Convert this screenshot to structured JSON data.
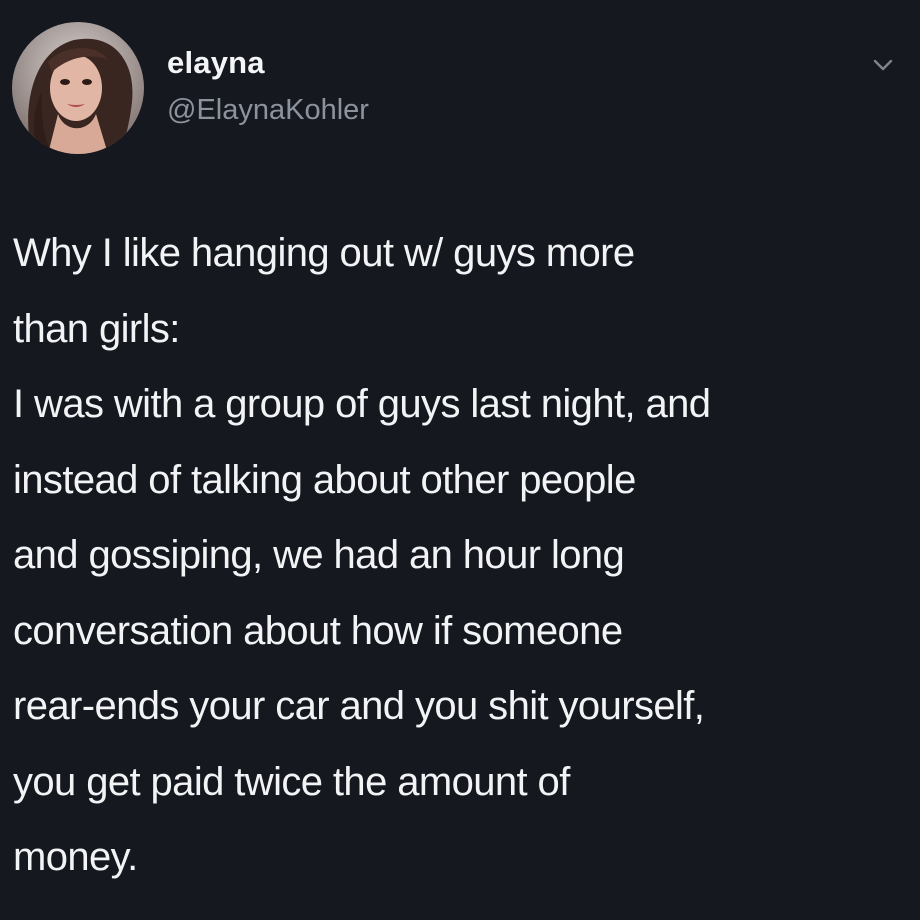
{
  "user": {
    "display_name": "elayna",
    "handle": "@ElaynaKohler",
    "avatar_icon": "profile-photo"
  },
  "menu": {
    "icon": "chevron-down-icon"
  },
  "tweet": {
    "lines": [
      "Why I like hanging out w/ guys more",
      "than girls:",
      "I was with a group of guys last night, and",
      "instead of talking about other people",
      "and gossiping, we had an hour long",
      "conversation about how if someone",
      "rear-ends your car and you shit yourself,",
      "you get paid twice the amount of",
      "money."
    ]
  },
  "colors": {
    "background": "#15181f",
    "text": "#f2f3f5",
    "secondary_text": "#8d939c"
  }
}
